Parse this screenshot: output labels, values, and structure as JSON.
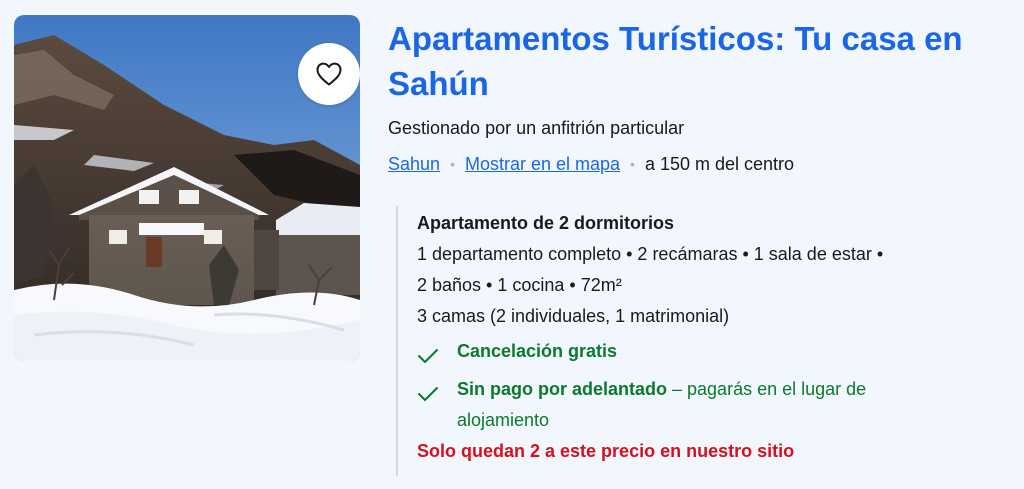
{
  "listing": {
    "title": "Apartamentos Turísticos: Tu casa en Sahún",
    "managed_by": "Gestionado por un anfitrión particular",
    "location": {
      "town_link": "Sahun",
      "map_link": "Mostrar en el mapa",
      "distance": "a 150 m del centro"
    },
    "favorite_icon": "heart-outline-icon",
    "photo_description_icon": "photo"
  },
  "unit": {
    "title": "Apartamento de 2 dormitorios",
    "specs_line1": "1 departamento completo • 2 recámaras • 1 sala de estar •",
    "specs_line2": "2 baños • 1 cocina • 72m²",
    "beds": "3 camas (2 individuales, 1 matrimonial)"
  },
  "perks": {
    "cancellation": "Cancelación gratis",
    "no_prepay_bold": "Sin pago por adelantado",
    "no_prepay_rest_line1": " – pagarás en el lugar de",
    "no_prepay_rest_line2": "alojamiento"
  },
  "scarcity": "Solo quedan 2 a este precio en nuestro sitio",
  "colors": {
    "link_blue": "#1a66e6",
    "success_green": "#0b7a2e",
    "alert_red": "#d4111e",
    "background": "#f2f6fd"
  }
}
